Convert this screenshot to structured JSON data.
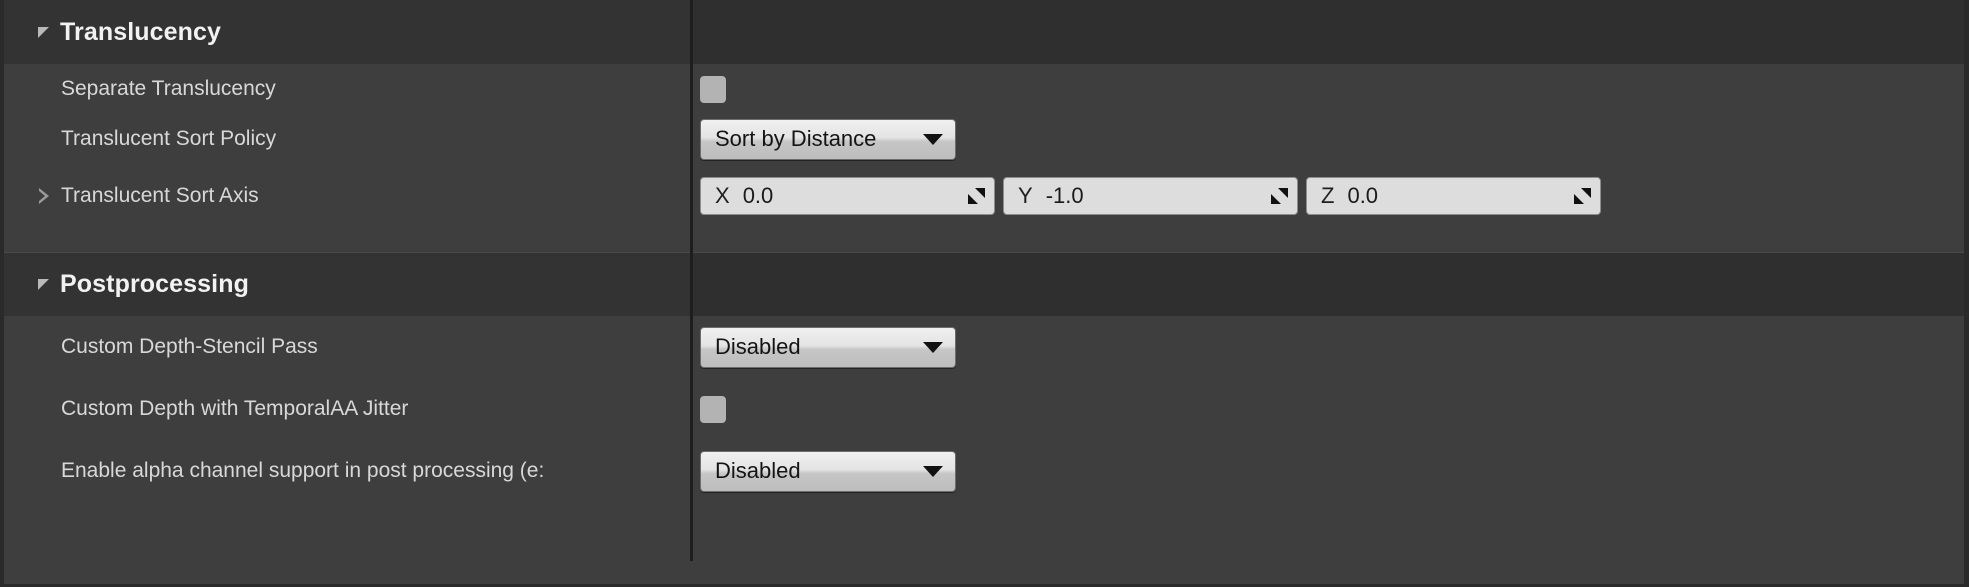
{
  "panel": {
    "name": "details-panel",
    "colors": {
      "panel_background": "#3e3e3e",
      "section_header_background": "#2f2f2f",
      "section_header_label_background": "#333333",
      "label_text": "#d8d8d8",
      "title_text": "#f2f2f2",
      "splitter": "#1e1e1e",
      "control_light": "#dddddd",
      "checkbox_fill": "#b3b3b3",
      "combo_text": "#141414"
    }
  },
  "sections": [
    {
      "id": "translucency",
      "title": "Translucency",
      "expander_icon": "triangle-down-icon",
      "expanded": true,
      "rows": [
        {
          "id": "separate-translucency",
          "label": "Separate Translucency",
          "expander": false,
          "control": "checkbox",
          "checked": false
        },
        {
          "id": "translucent-sort-policy",
          "label": "Translucent Sort Policy",
          "expander": false,
          "control": "combo",
          "value": "Sort by Distance",
          "arrow_icon": "chevron-down-icon"
        },
        {
          "id": "translucent-sort-axis",
          "label": "Translucent Sort Axis",
          "expander": true,
          "expander_icon": "triangle-right-icon",
          "control": "vector",
          "axes": [
            {
              "axis": "X",
              "value": "0.0",
              "handle_icon": "drag-handle-icon"
            },
            {
              "axis": "Y",
              "value": "-1.0",
              "handle_icon": "drag-handle-icon"
            },
            {
              "axis": "Z",
              "value": "0.0",
              "handle_icon": "drag-handle-icon"
            }
          ]
        }
      ]
    },
    {
      "id": "postprocessing",
      "title": "Postprocessing",
      "expander_icon": "triangle-down-icon",
      "expanded": true,
      "rows": [
        {
          "id": "custom-depth-stencil-pass",
          "label": "Custom Depth-Stencil Pass",
          "expander": false,
          "control": "combo",
          "value": "Disabled",
          "arrow_icon": "chevron-down-icon"
        },
        {
          "id": "custom-depth-temporalaa-jitter",
          "label": "Custom Depth with TemporalAA Jitter",
          "expander": false,
          "control": "checkbox",
          "checked": false
        },
        {
          "id": "enable-alpha-channel-support",
          "label": "Enable alpha channel support in post processing (e:",
          "expander": false,
          "control": "combo",
          "value": "Disabled",
          "arrow_icon": "chevron-down-icon"
        }
      ]
    }
  ]
}
